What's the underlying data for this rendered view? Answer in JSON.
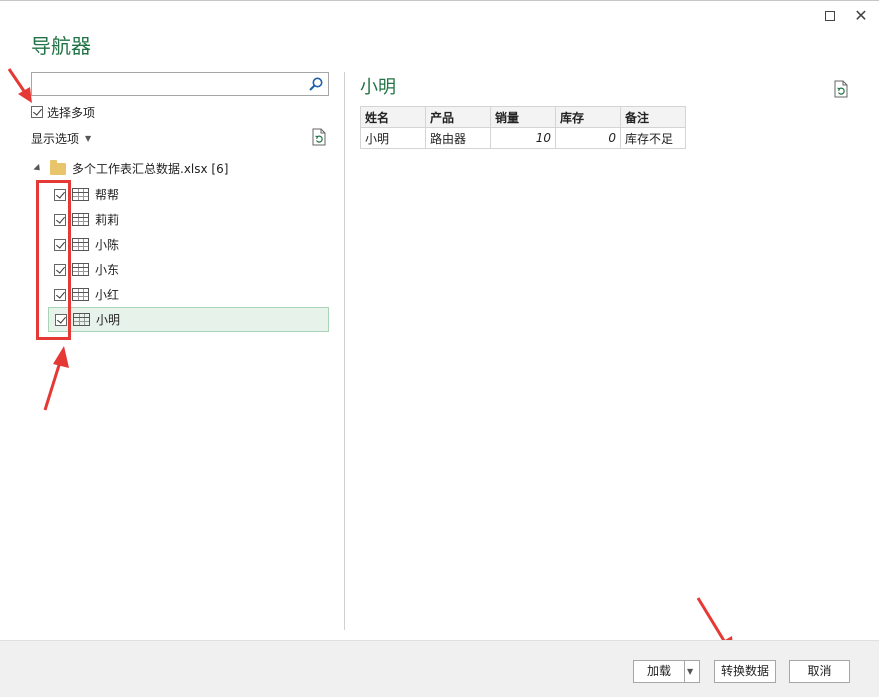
{
  "dialog": {
    "title": "导航器"
  },
  "left": {
    "search": {
      "value": "",
      "placeholder": ""
    },
    "select_multiple_label": "选择多项",
    "display_options_label": "显示选项",
    "tree": {
      "root_label": "多个工作表汇总数据.xlsx [6]",
      "items": [
        {
          "label": "帮帮",
          "checked": true
        },
        {
          "label": "莉莉",
          "checked": true
        },
        {
          "label": "小陈",
          "checked": true
        },
        {
          "label": "小东",
          "checked": true
        },
        {
          "label": "小红",
          "checked": true
        },
        {
          "label": "小明",
          "checked": true,
          "selected": true
        }
      ]
    }
  },
  "preview": {
    "title": "小明",
    "columns": [
      "姓名",
      "产品",
      "销量",
      "库存",
      "备注"
    ],
    "rows": [
      [
        "小明",
        "路由器",
        "10",
        "0",
        "库存不足"
      ]
    ]
  },
  "footer": {
    "load_label": "加载",
    "transform_label": "转换数据",
    "cancel_label": "取消"
  },
  "colors": {
    "accent": "#217346",
    "annotation": "#e53935"
  }
}
